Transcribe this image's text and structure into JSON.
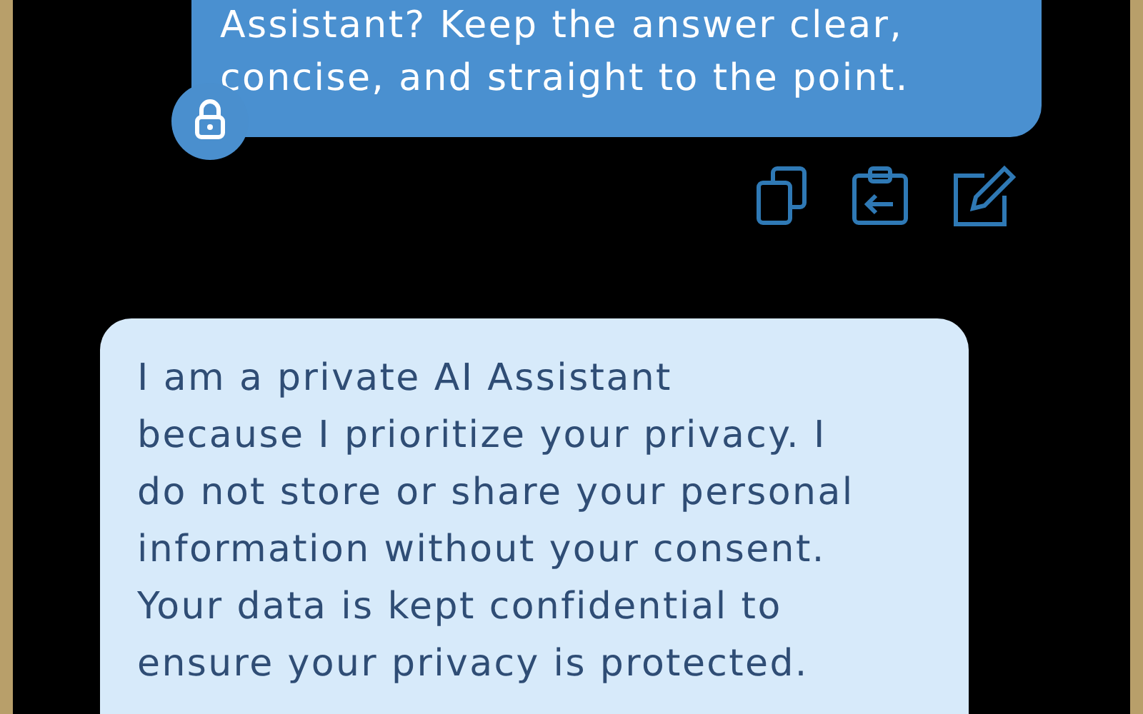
{
  "messages": [
    {
      "kind": "user",
      "text": "Assistant? Keep the answer clear,\nconcise, and straight to the point.",
      "private": true
    },
    {
      "kind": "assistant",
      "text": "I am a private AI Assistant\nbecause I prioritize your privacy. I\ndo not store or share your personal\ninformation without your consent.\nYour data is kept confidential to\nensure your privacy is protected."
    }
  ]
}
